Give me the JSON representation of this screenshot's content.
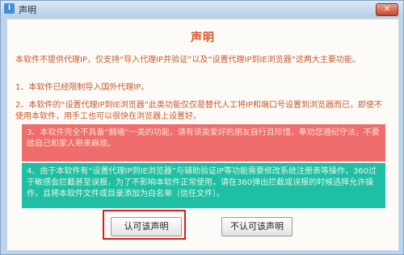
{
  "window": {
    "title": "声明",
    "app_icon": "app-icon",
    "close_icon": "close-icon",
    "close_glyph": "✕"
  },
  "statement": {
    "heading": "声明",
    "intro": "本软件不提供代理IP，仅支持“导入代理IP并验证”以及“设置代理IP到IE浏览器”这两大主要功能。",
    "item1": "1、本软件已经限制导入国外代理IP。",
    "item2": "2、本软件的“设置代理IP到IE浏览器”此类功能仅仅是替代人工将IP和端口号设置到浏览器而已，即使不使用本软件，用手工也可以很快在浏览器上设置好。",
    "item3": "3、本软件完全不具备“翻墙”一类的功能，请有该类爱好的朋友自行且珍惜，奉劝您遵纪守法，不要给自己和家人带来麻烦。",
    "item4": "4、由于本软件有“设置代理IP到IE浏览器”与辅助验证IP等功能需要修改系统注册表等操作，360过于敏感会拦截甚至误报，为了不影响本软件正常使用，请在360弹出拦截或误报的时候选择允许操作，且将本软件文件或目录添加为白名单（信任文件）。"
  },
  "buttons": {
    "accept": "认可该声明",
    "decline": "不认可该声明"
  },
  "colors": {
    "heading": "#d8552a",
    "text": "#c85a2e",
    "notice_red": "#ef6d6d",
    "notice_teal": "#1fbfa6",
    "highlight": "#e01b1b"
  }
}
